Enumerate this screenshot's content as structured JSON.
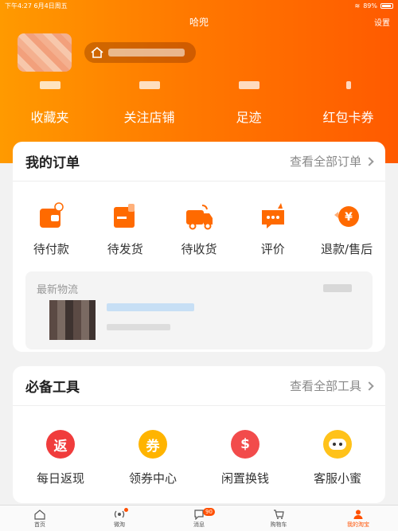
{
  "status_bar": {
    "time_date": "下午4:27  6月4日周五",
    "battery": "89%"
  },
  "header": {
    "title": "哈兜",
    "settings": "设置"
  },
  "stats": [
    {
      "label": "收藏夹"
    },
    {
      "label": "关注店铺"
    },
    {
      "label": "足迹"
    },
    {
      "label": "红包卡券"
    }
  ],
  "orders": {
    "title": "我的订单",
    "link": "查看全部订单",
    "items": [
      {
        "label": "待付款",
        "icon": "wallet-icon"
      },
      {
        "label": "待发货",
        "icon": "package-icon"
      },
      {
        "label": "待收货",
        "icon": "truck-icon"
      },
      {
        "label": "评价",
        "icon": "comment-icon"
      },
      {
        "label": "退款/售后",
        "icon": "refund-icon"
      }
    ],
    "logistics_title": "最新物流"
  },
  "tools": {
    "title": "必备工具",
    "link": "查看全部工具",
    "items": [
      {
        "label": "每日返现",
        "glyph": "返",
        "color": "#f03c3c"
      },
      {
        "label": "领券中心",
        "glyph": "券",
        "color": "#ffb400"
      },
      {
        "label": "闲置换钱",
        "glyph": "$",
        "color": "#f24b4b"
      },
      {
        "label": "客服小蜜",
        "glyph": "",
        "color": "#ffc21a"
      }
    ]
  },
  "tabbar": [
    {
      "label": "首页"
    },
    {
      "label": "微淘"
    },
    {
      "label": "消息",
      "badge": "90"
    },
    {
      "label": "购物车"
    },
    {
      "label": "我的淘宝"
    }
  ],
  "colors": {
    "brand": "#ff5000",
    "accent": "#ff7a00"
  }
}
